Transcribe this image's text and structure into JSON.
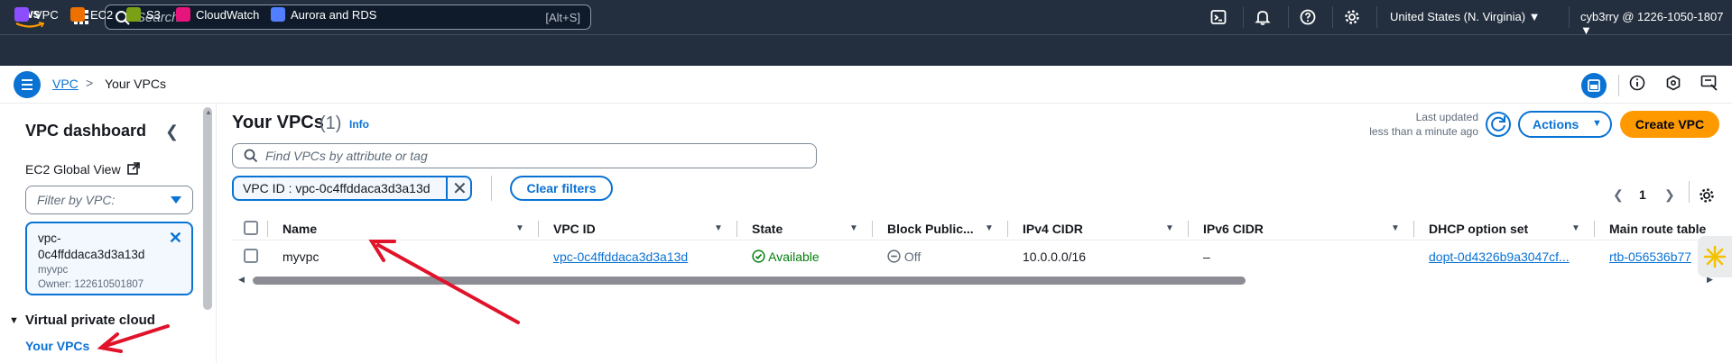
{
  "topbar": {
    "logo_text": "aws",
    "search_placeholder": "Search",
    "search_shortcut": "[Alt+S]",
    "region": "United States (N. Virginia)",
    "account": "cyb3rry @ 1226-1050-1807"
  },
  "favorites": [
    {
      "label": "VPC",
      "color": "#8c4fff"
    },
    {
      "label": "EC2",
      "color": "#ed7100"
    },
    {
      "label": "S3",
      "color": "#7aa116"
    },
    {
      "label": "CloudWatch",
      "color": "#e7157b"
    },
    {
      "label": "Aurora and RDS",
      "color": "#527fff"
    }
  ],
  "breadcrumb": {
    "root": "VPC",
    "separator": ">",
    "current": "Your VPCs"
  },
  "sidebar": {
    "title": "VPC dashboard",
    "ec2_global_view": "EC2 Global View",
    "filter_placeholder": "Filter by VPC:",
    "selected_vpc": {
      "id": "vpc-\n0c4ffddaca3d3a13d",
      "name": "myvpc",
      "owner": "Owner: 122610501807"
    },
    "section": "Virtual private cloud",
    "active_link": "Your VPCs"
  },
  "main": {
    "title": "Your VPCs",
    "count": "(1)",
    "info": "Info",
    "last_updated_label": "Last updated",
    "last_updated_value": "less than a minute ago",
    "actions_label": "Actions",
    "create_label": "Create VPC",
    "find_placeholder": "Find VPCs by attribute or tag",
    "filter_token": "VPC ID : vpc-0c4ffddaca3d3a13d",
    "clear_filters": "Clear filters",
    "page_number": "1"
  },
  "table": {
    "columns": [
      "Name",
      "VPC ID",
      "State",
      "Block Public...",
      "IPv4 CIDR",
      "IPv6 CIDR",
      "DHCP option set",
      "Main route table"
    ],
    "rows": [
      {
        "name": "myvpc",
        "vpc_id": "vpc-0c4ffddaca3d3a13d",
        "state": "Available",
        "block_public": "Off",
        "ipv4": "10.0.0.0/16",
        "ipv6": "–",
        "dhcp": "dopt-0d4326b9a3047cf...",
        "route_table": "rtb-056536b77"
      }
    ]
  },
  "colors": {
    "nav_bg": "#232f3e",
    "link": "#0972d3",
    "primary_button": "#ff9900",
    "success": "#037f0c",
    "annotation_arrow": "#e0132b"
  }
}
